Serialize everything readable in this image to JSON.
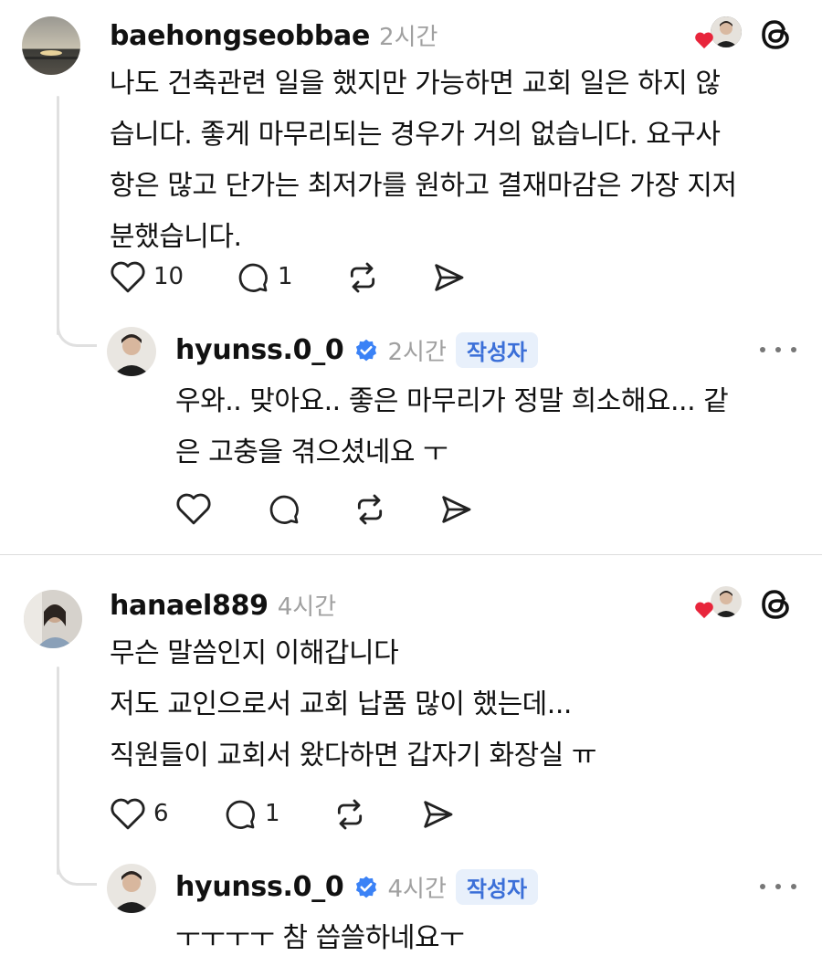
{
  "comments": [
    {
      "username": "baehongseobbae",
      "time": "2시간",
      "text_lines": [
        "나도 건축관련 일을 했지만 가능하면 교회 일은 하지 않",
        "습니다. 좋게 마무리되는 경우가 거의 없습니다. 요구사",
        "항은 많고 단가는 최저가를 원하고 결재마감은 가장 지저",
        "분했습니다."
      ],
      "likes": "10",
      "replies": "1",
      "reply": {
        "username": "hyunss.0_0",
        "time": "2시간",
        "badge": "작성자",
        "text_lines": [
          "우와.. 맞아요.. 좋은 마무리가 정말 희소해요... 같",
          "은 고충을 겪으셨네요 ㅜ"
        ]
      }
    },
    {
      "username": "hanael889",
      "time": "4시간",
      "text_lines": [
        "무슨 말씀인지 이해갑니다",
        "저도 교인으로서 교회 납품 많이 했는데...",
        "직원들이 교회서 왔다하면 갑자기 화장실 ㅠ"
      ],
      "likes": "6",
      "replies": "1",
      "reply": {
        "username": "hyunss.0_0",
        "time": "4시간",
        "badge": "작성자",
        "text_lines": [
          "ㅜㅜㅜㅜ 참 씁쓸하네요ㅜ"
        ]
      }
    }
  ],
  "colors": {
    "verified": "#3b82f6",
    "heart": "#e8253b",
    "badge_bg": "#e8f0fb",
    "badge_text": "#3b6fd8"
  }
}
